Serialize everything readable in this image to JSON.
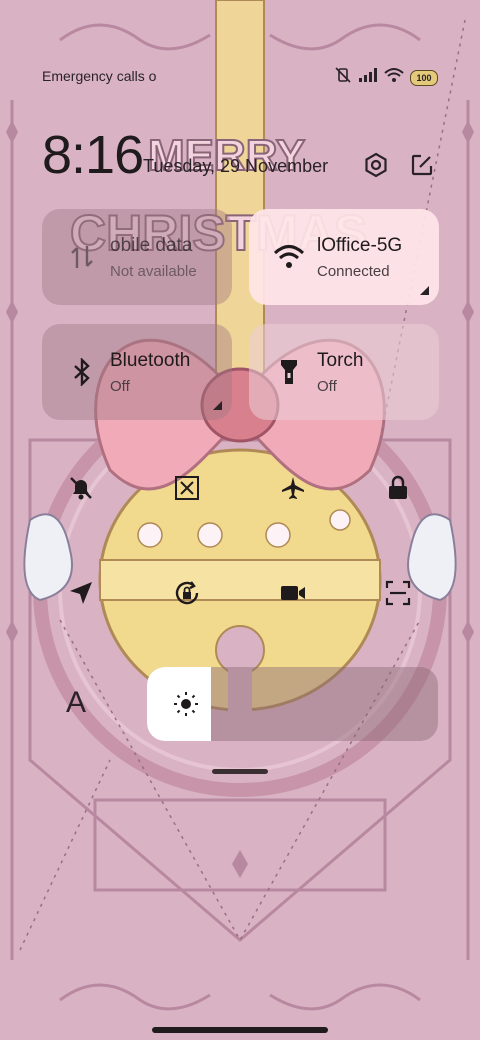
{
  "status_bar": {
    "carrier_text": "Emergency calls o",
    "icons": [
      "vibrate-off-icon",
      "signal-icon",
      "wifi-icon",
      "battery-icon"
    ],
    "battery_level": "100"
  },
  "header": {
    "time": "8:16",
    "date": "Tuesday, 29 November",
    "settings_icon": "gear-icon",
    "edit_icon": "edit-icon"
  },
  "wallpaper": {
    "greeting_line1": "MERRY",
    "greeting_line2": "CHRISTMAS"
  },
  "tiles": [
    {
      "name": "obile data",
      "status": "Not available",
      "icon": "mobile-data-icon",
      "state": "unavailable"
    },
    {
      "name": "lOffice-5G",
      "status": "Connected",
      "icon": "wifi-icon",
      "state": "on"
    },
    {
      "name": "Bluetooth",
      "status": "Off",
      "icon": "bluetooth-icon",
      "state": "off"
    },
    {
      "name": "Torch",
      "status": "Off",
      "icon": "torch-icon",
      "state": "off"
    }
  ],
  "quick_toggles": [
    {
      "name": "mute",
      "icon": "bell-off-icon"
    },
    {
      "name": "screenshot",
      "icon": "scissors-icon"
    },
    {
      "name": "airplane-mode",
      "icon": "airplane-icon"
    },
    {
      "name": "lock-screen",
      "icon": "lock-icon"
    },
    {
      "name": "location",
      "icon": "location-arrow-icon"
    },
    {
      "name": "rotation-lock",
      "icon": "rotation-lock-icon"
    },
    {
      "name": "screen-recorder",
      "icon": "video-camera-icon"
    },
    {
      "name": "scanner",
      "icon": "scanner-icon"
    }
  ],
  "brightness": {
    "auto_label": "A",
    "level": 0.22
  },
  "colors": {
    "wallpaper_bg": "#d9b3c4",
    "active_tile": "#ffe6e8",
    "bow": "#f0aab8",
    "bell": "#f1d98e"
  }
}
